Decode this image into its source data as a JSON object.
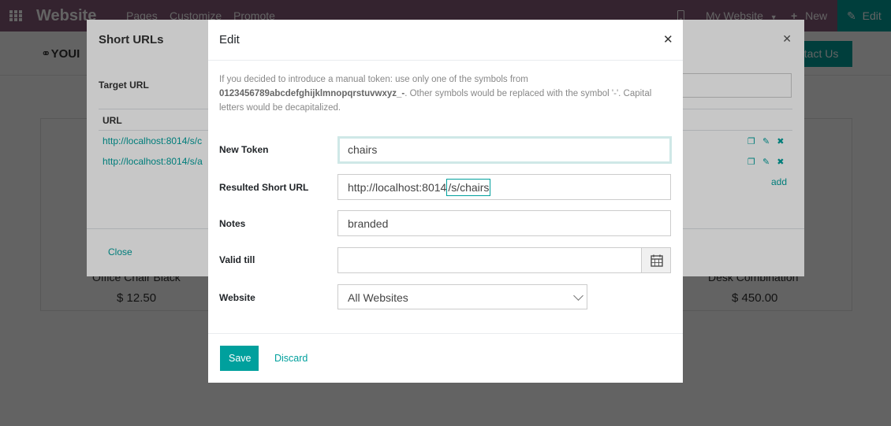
{
  "topbar": {
    "brand": "Website",
    "menu": [
      "Pages",
      "Customize",
      "Promote"
    ],
    "website_selector": "My Website",
    "new_label": "New",
    "edit_label": "Edit"
  },
  "site": {
    "logo_text": "YOUI",
    "contact_label": "ntact Us",
    "products": [
      {
        "name": "Office Chair Black",
        "price": "$ 12.50"
      },
      {
        "name": "Desk Combination",
        "price": "$ 450.00"
      }
    ]
  },
  "short_urls_dialog": {
    "title": "Short URLs",
    "target_label": "Target URL",
    "url_header": "URL",
    "rows": [
      "http://localhost:8014/s/c",
      "http://localhost:8014/s/a"
    ],
    "add_label": "add",
    "close_label": "Close"
  },
  "edit_dialog": {
    "title": "Edit",
    "help_text_1": "If you decided to introduce a manual token: use only one of the symbols from",
    "help_symbols": "0123456789abcdefghijklmnopqrstuvwxyz_-",
    "help_text_2": ". Other symbols would be replaced with the symbol '-'. Capital letters would be decapitalized.",
    "new_token_label": "New Token",
    "new_token_value": "chairs",
    "result_label": "Resulted Short URL",
    "result_prefix": "http://localhost:8014",
    "result_suffix": "/s/chairs",
    "notes_label": "Notes",
    "notes_value": "branded",
    "valid_label": "Valid till",
    "valid_value": "",
    "website_label": "Website",
    "website_value": "All Websites",
    "save_label": "Save",
    "discard_label": "Discard"
  }
}
